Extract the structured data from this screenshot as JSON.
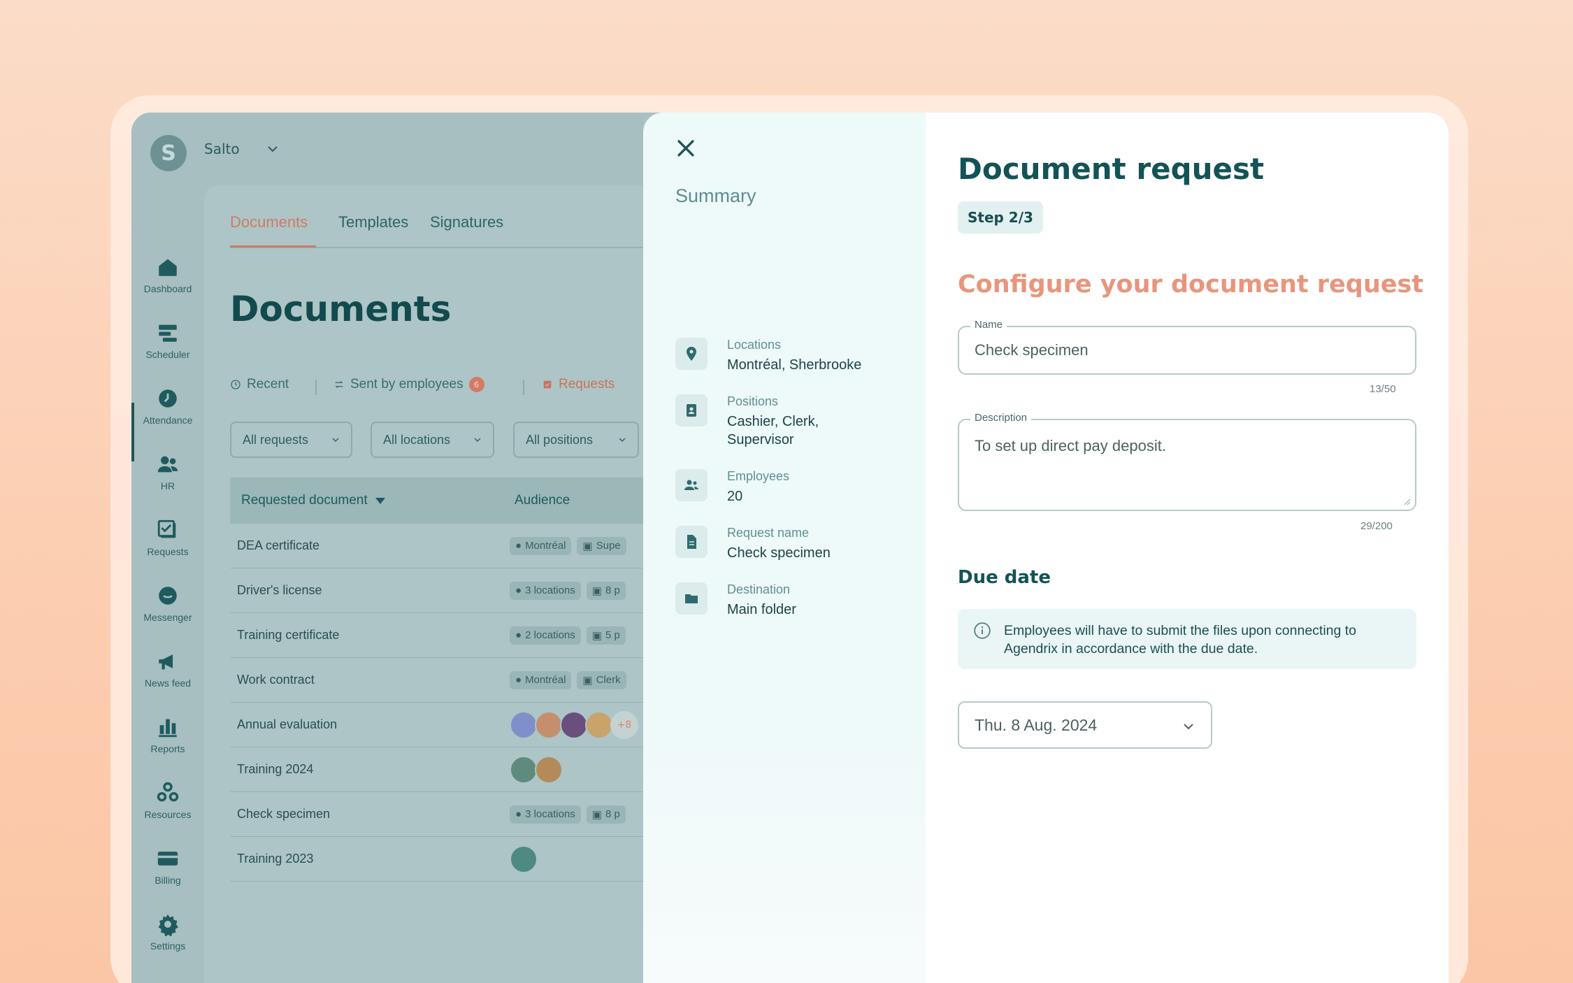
{
  "org": {
    "initial": "S",
    "name": "Salto"
  },
  "sidebar": {
    "items": [
      {
        "label": "Dashboard",
        "icon": "home-icon"
      },
      {
        "label": "Scheduler",
        "icon": "scheduler-icon"
      },
      {
        "label": "Attendance",
        "icon": "clock-icon"
      },
      {
        "label": "HR",
        "icon": "people-icon"
      },
      {
        "label": "Requests",
        "icon": "checklist-icon"
      },
      {
        "label": "Messenger",
        "icon": "chat-icon"
      },
      {
        "label": "News feed",
        "icon": "megaphone-icon"
      },
      {
        "label": "Reports",
        "icon": "bar-chart-icon"
      },
      {
        "label": "Resources",
        "icon": "resources-icon"
      },
      {
        "label": "Billing",
        "icon": "credit-card-icon"
      },
      {
        "label": "Settings",
        "icon": "gear-icon"
      }
    ],
    "active": "HR"
  },
  "tabs": [
    {
      "label": "Documents",
      "active": true
    },
    {
      "label": "Templates"
    },
    {
      "label": "Signatures"
    }
  ],
  "page_title": "Documents",
  "subtabs": {
    "recent": "Recent",
    "sent_by_employees": "Sent by employees",
    "sent_count": "6",
    "requests": "Requests"
  },
  "filters": [
    "All requests",
    "All locations",
    "All positions"
  ],
  "table": {
    "headers": {
      "document": "Requested document",
      "audience": "Audience"
    },
    "rows": [
      {
        "name": "DEA certificate",
        "chips": [
          "Montréal",
          "Supe"
        ]
      },
      {
        "name": "Driver's license",
        "chips": [
          "3 locations",
          "8 p"
        ]
      },
      {
        "name": "Training certificate",
        "chips": [
          "2 locations",
          "5 p"
        ]
      },
      {
        "name": "Work contract",
        "chips": [
          "Montréal",
          "Clerk"
        ]
      },
      {
        "name": "Annual evaluation",
        "avatars": 4,
        "more": "+8"
      },
      {
        "name": "Training 2024",
        "avatars": 2
      },
      {
        "name": "Check specimen",
        "chips": [
          "3 locations",
          "8 p"
        ]
      },
      {
        "name": "Training 2023",
        "avatars": 1
      }
    ]
  },
  "summary": {
    "title": "Summary",
    "items": [
      {
        "label": "Locations",
        "value": "Montréal, Sherbrooke",
        "icon": "location-pin-icon"
      },
      {
        "label": "Positions",
        "value": "Cashier, Clerk, Supervisor",
        "icon": "badge-icon"
      },
      {
        "label": "Employees",
        "value": "20",
        "icon": "people-icon"
      },
      {
        "label": "Request name",
        "value": "Check specimen",
        "icon": "document-icon"
      },
      {
        "label": "Destination",
        "value": "Main folder",
        "icon": "folder-icon"
      }
    ]
  },
  "form": {
    "title": "Document request",
    "step": "Step 2/3",
    "section": "Configure your document request",
    "name": {
      "label": "Name",
      "value": "Check specimen",
      "counter": "13/50"
    },
    "description": {
      "label": "Description",
      "value": "To set up direct pay deposit.",
      "counter": "29/200"
    },
    "due_heading": "Due date",
    "info": "Employees will have to submit the files upon connecting to Agendrix in accordance with the due date.",
    "due_date": "Thu. 8 Aug. 2024"
  },
  "colors": {
    "primary": "#135356",
    "accent": "#e8957e",
    "dimmed_bg": "#a7bfc0",
    "summary_bg": "#eef9f9"
  }
}
